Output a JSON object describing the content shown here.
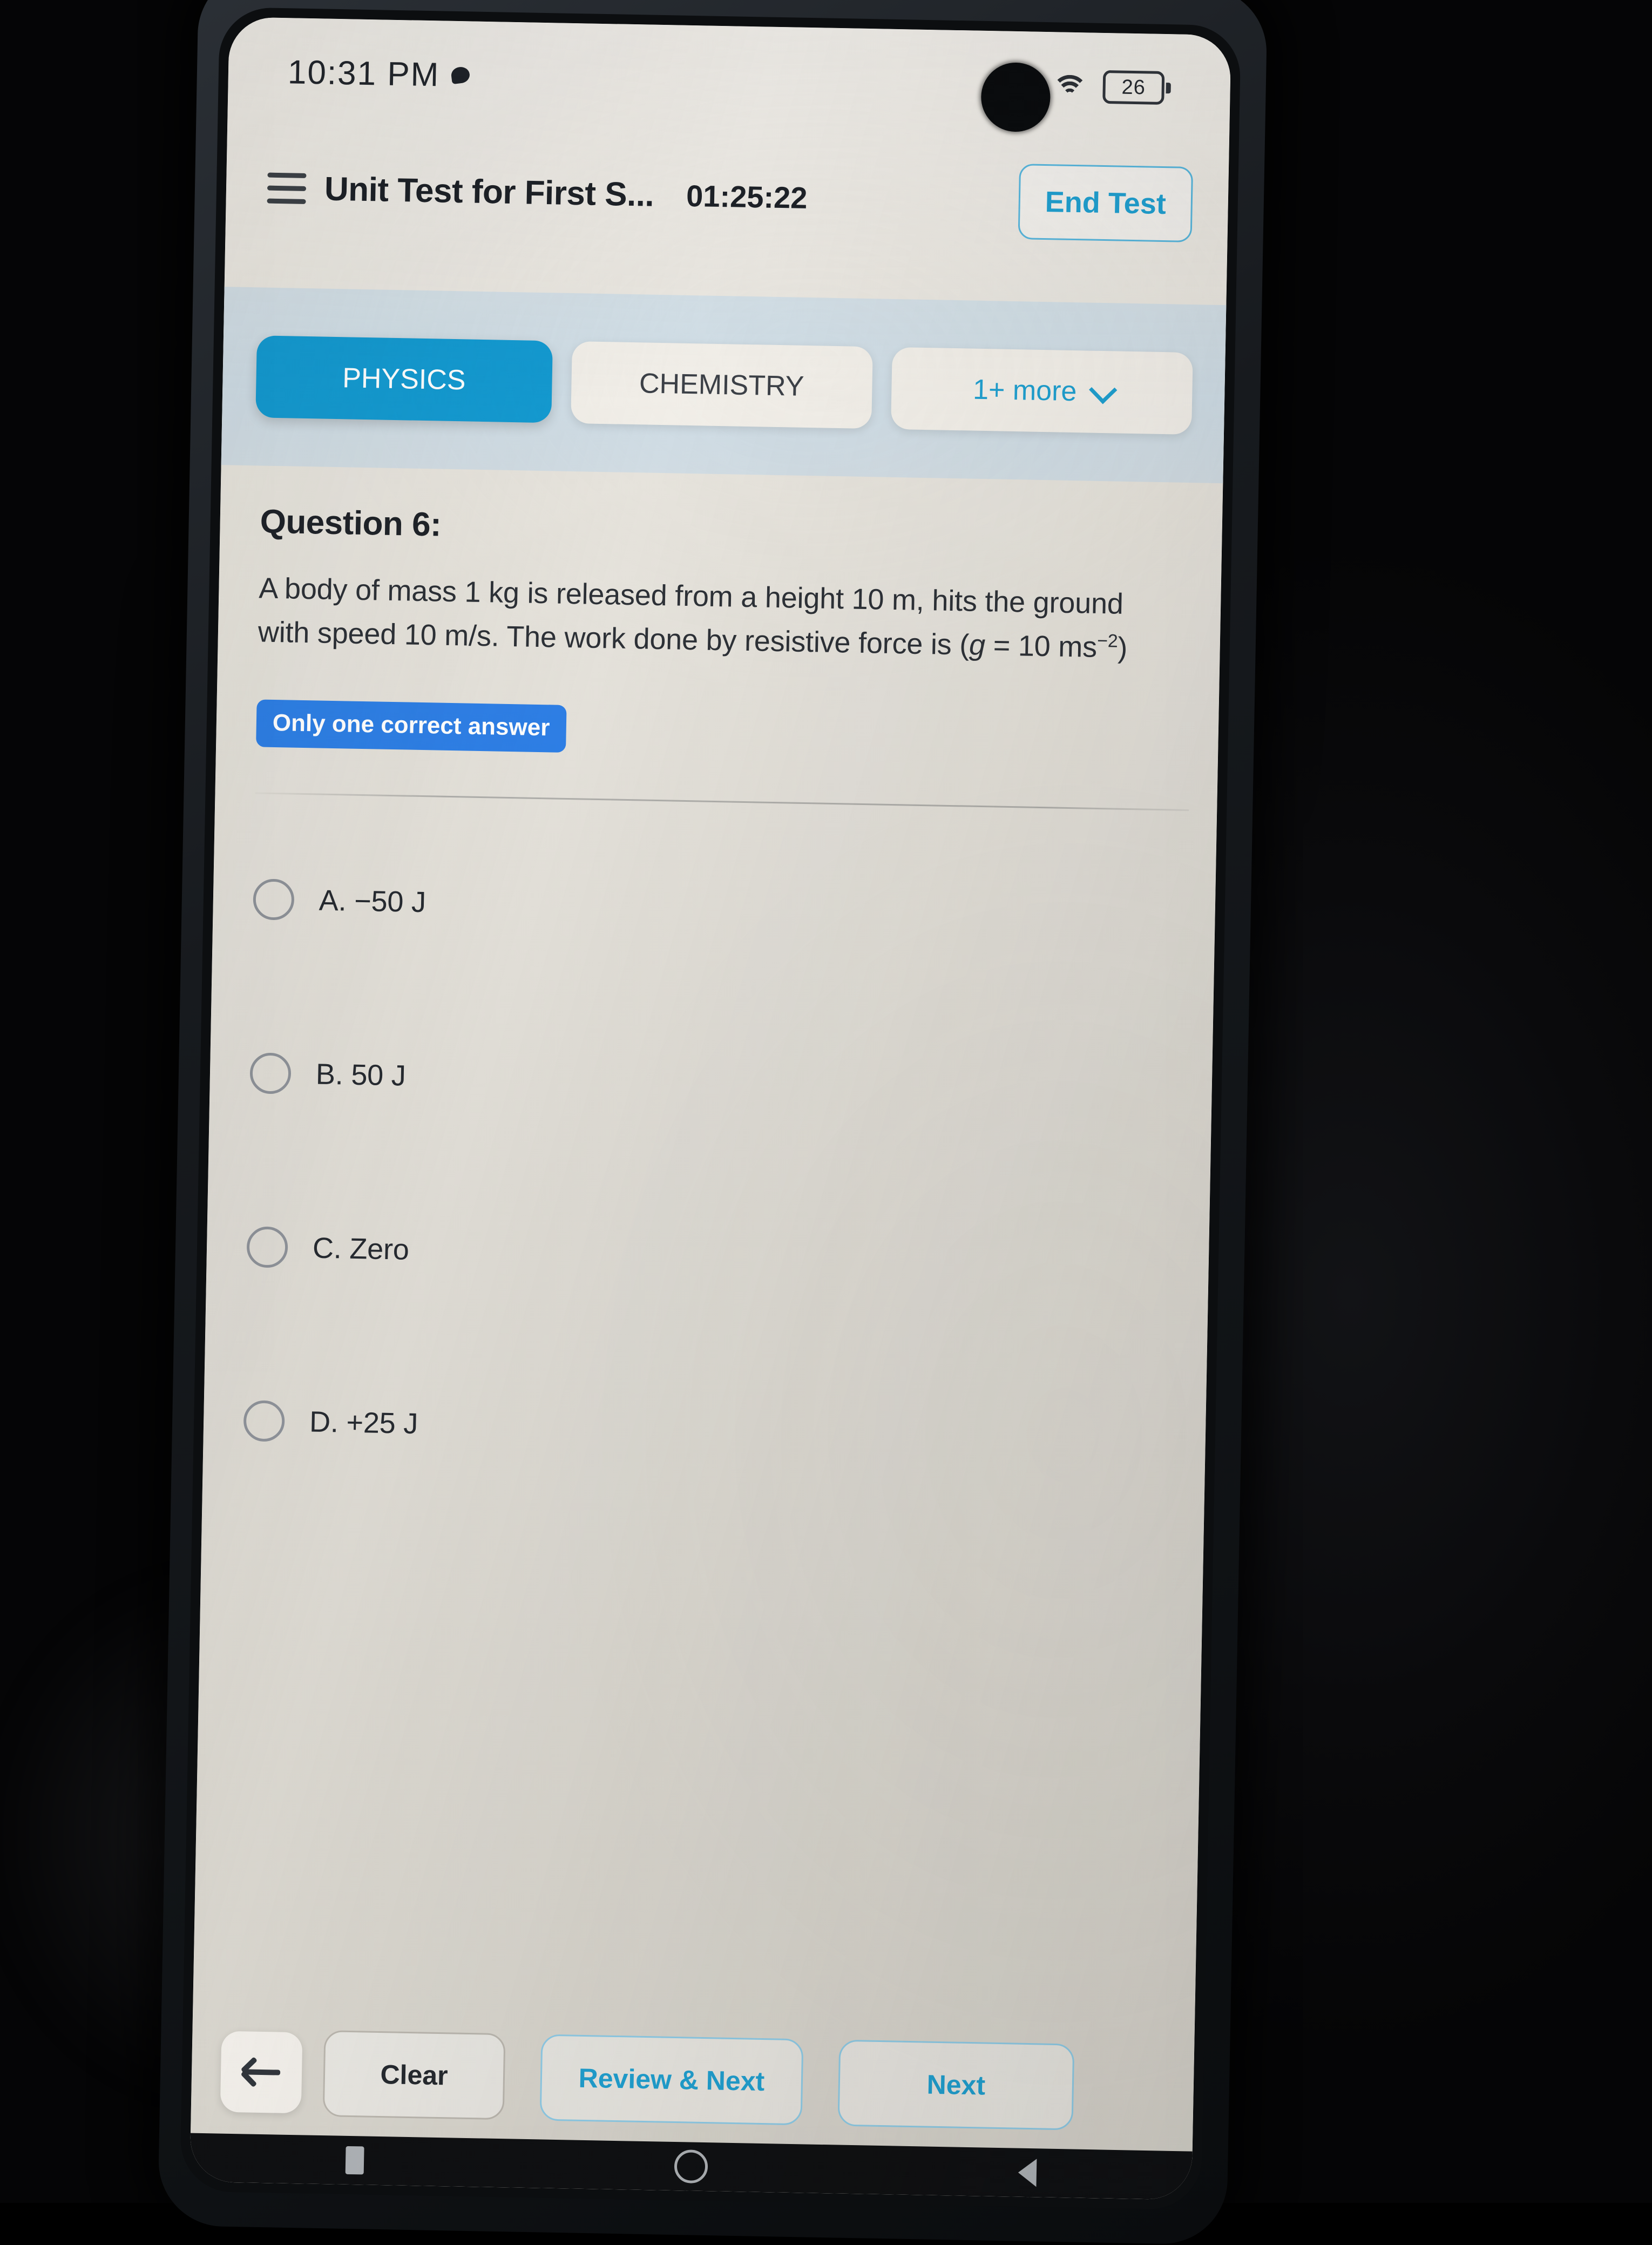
{
  "status_bar": {
    "time": "10:31 PM",
    "notification_icon": "notification-dot-icon",
    "signal_icon": "cellular-signal-icon",
    "wifi_icon": "wifi-icon",
    "battery_level": "26"
  },
  "header": {
    "menu_icon": "hamburger-menu-icon",
    "title": "Unit Test for First S...",
    "timer": "01:25:22",
    "end_test_label": "End Test"
  },
  "tabs": {
    "items": [
      {
        "label": "PHYSICS",
        "active": true
      },
      {
        "label": "CHEMISTRY",
        "active": false
      }
    ],
    "more_label": "1+ more",
    "more_chevron_icon": "chevron-down-icon"
  },
  "question": {
    "heading": "Question 6:",
    "text_part1": "A body of mass 1 kg is released from a height 10 m, hits the ground with speed 10 m/s. The work done by resistive force is (",
    "text_italic_g": "g",
    "text_part2": " = 10 ms",
    "exponent": "−2",
    "text_part3": ")",
    "badge_label": "Only one correct answer"
  },
  "options": [
    {
      "label": "A. −50 J",
      "selected": false
    },
    {
      "label": "B. 50 J",
      "selected": false
    },
    {
      "label": "C. Zero",
      "selected": false
    },
    {
      "label": "D. +25 J",
      "selected": false
    }
  ],
  "bottom_bar": {
    "back_icon": "arrow-left-icon",
    "clear_label": "Clear",
    "review_next_label": "Review & Next",
    "next_label": "Next"
  },
  "android_nav": {
    "recents_icon": "recents-icon",
    "home_icon": "home-icon",
    "back_icon": "back-triangle-icon"
  },
  "colors": {
    "accent_blue": "#1e9fd0",
    "tab_active_blue": "#129ad2",
    "badge_blue": "#2c7ee6",
    "page_bg": "#e7e4dd",
    "tabbar_bg": "#d0dde5"
  }
}
